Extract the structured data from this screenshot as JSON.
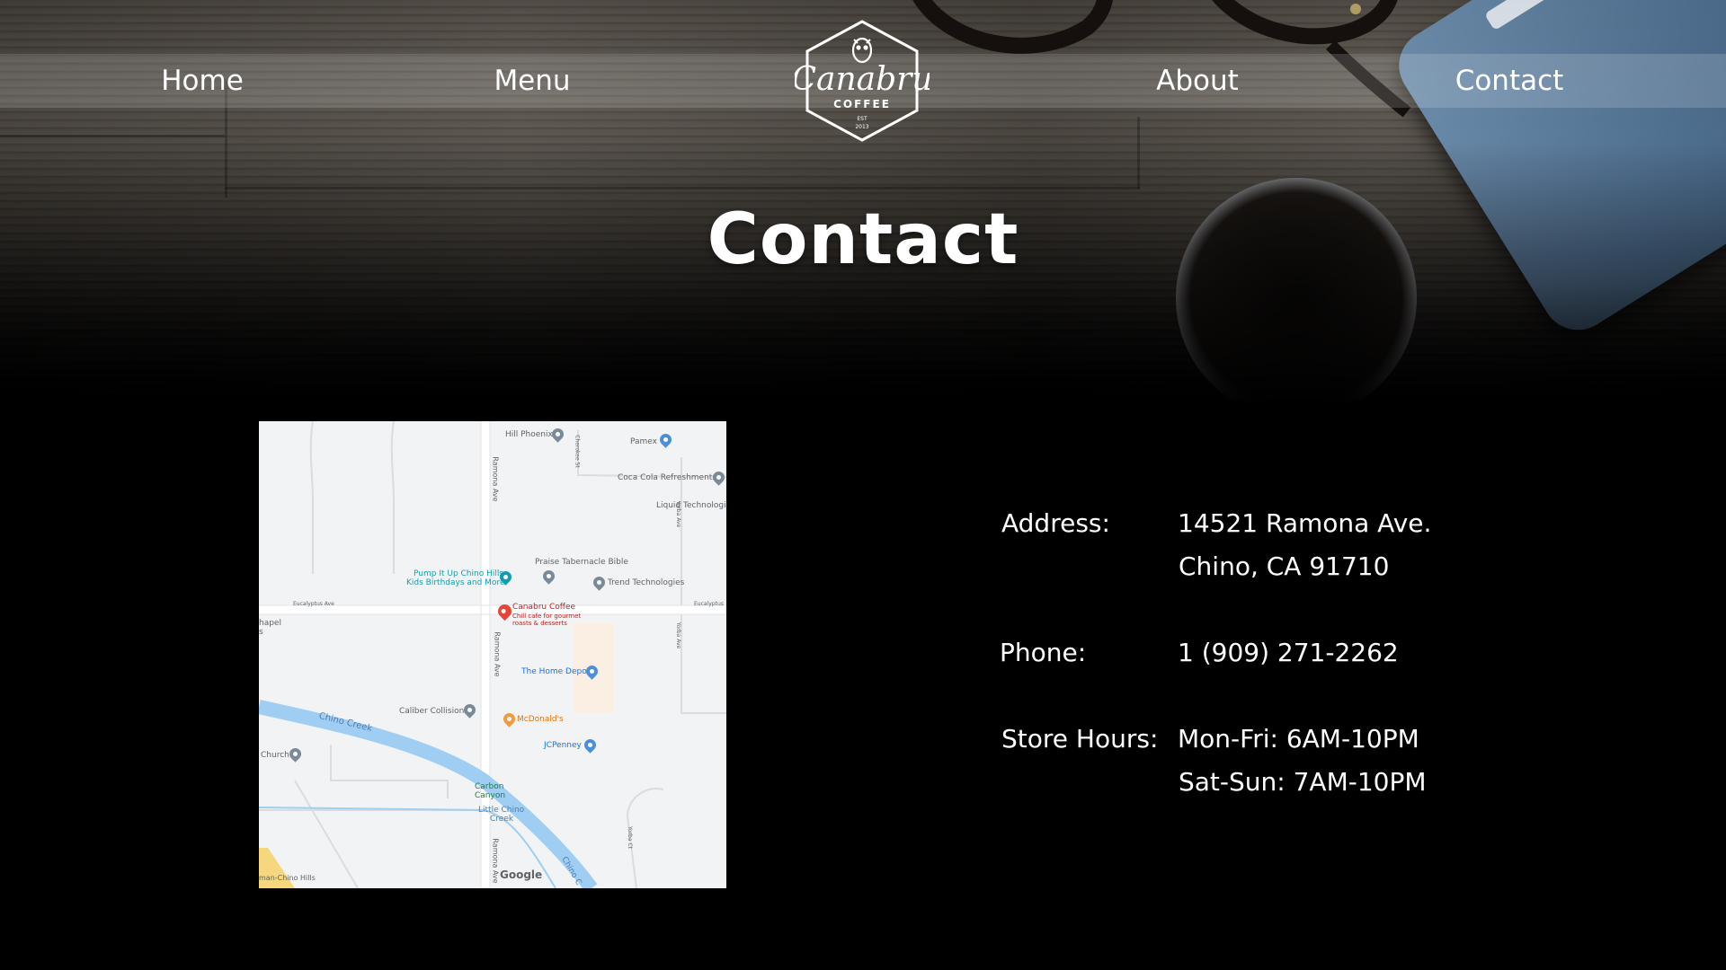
{
  "nav": {
    "home": "Home",
    "menu": "Menu",
    "about": "About",
    "contact": "Contact"
  },
  "logo": {
    "script": "Canabru",
    "sub": "COFFEE",
    "est": "EST",
    "year": "2013"
  },
  "page_title": "Contact",
  "map": {
    "places": {
      "hill_phoenix": "Hill Phoenix",
      "pamex": "Pamex",
      "coca_cola": "Coca Cola Refreshments",
      "liquid_tech": "Liquid Technologie",
      "praise": "Praise Tabernacle Bible",
      "trend": "Trend Technologies",
      "pump_it_up_1": "Pump It Up Chino Hills",
      "pump_it_up_2": "Kids Birthdays and More",
      "canabru": "Canabru Coffee",
      "canabru_desc_1": "Chill cafe for gourmet",
      "canabru_desc_2": "roasts & desserts",
      "home_depot": "The Home Depot",
      "caliber": "Caliber Collision",
      "mcdonalds": "McDonald's",
      "jcpenney": "JCPenney",
      "church": "Church",
      "chapel_1": "hapel",
      "chapel_2": "s",
      "carbon_1": "Carbon",
      "carbon_2": "Canyon",
      "little_chino_1": "Little Chino",
      "little_chino_2": "Creek",
      "chino_hills": "man-Chino Hills"
    },
    "streets": {
      "ramona_1": "Ramona Ave",
      "ramona_2": "Ramona Ave",
      "ramona_3": "Ramona Ave",
      "eucalyptus_left": "Eucalyptus Ave",
      "eucalyptus_right": "Eucalyptus",
      "yorba": "Yorba Ave",
      "yorba_2": "Yorba Ave",
      "cherokee": "Cherokee St",
      "yorba_ct": "Yorba Ct",
      "chino_creek": "Chino Creek",
      "chino_creek_2": "Chino C"
    },
    "attribution": "Google"
  },
  "contact": {
    "address_label": "Address:",
    "address_line1": "14521 Ramona Ave.",
    "address_line2": "Chino, CA 91710",
    "phone_label": "Phone:",
    "phone_value": "1 (909) 271-2262",
    "hours_label": "Store Hours:",
    "hours_line1": "Mon-Fri: 6AM-10PM",
    "hours_line2": "Sat-Sun: 7AM-10PM"
  },
  "colors": {
    "background": "#000000",
    "text": "#ffffff",
    "nav_bar": "rgba(255,255,255,0.16)",
    "map_bg": "#f1f3f4",
    "map_water": "#a0cef2",
    "map_pin_red": "#ea4335",
    "map_teal": "#129eaf"
  }
}
